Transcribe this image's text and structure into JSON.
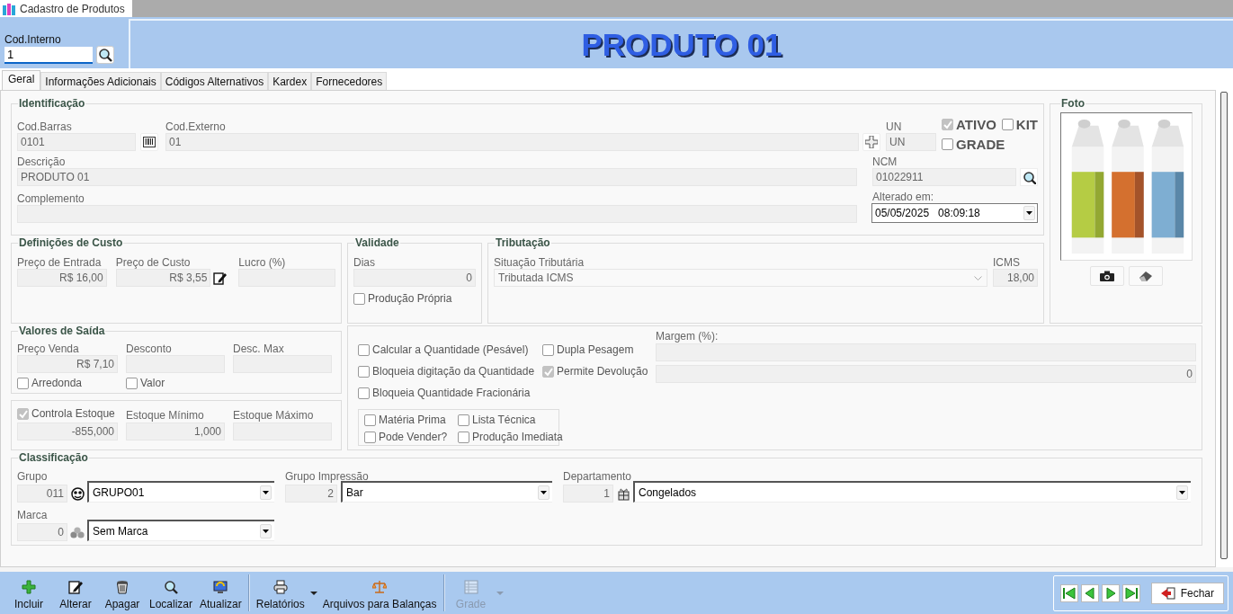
{
  "window_tab": {
    "title": "Cadastro de Produtos",
    "selected": true
  },
  "header": {
    "cod_interno": {
      "label": "Cod.Interno",
      "value": "1"
    },
    "title": "PRODUTO 01"
  },
  "tabs": [
    {
      "label": "Geral",
      "selected": true
    },
    {
      "label": "Informações Adicionais",
      "selected": false
    },
    {
      "label": "Códigos Alternativos",
      "selected": false
    },
    {
      "label": "Kardex",
      "selected": false
    },
    {
      "label": "Fornecedores",
      "selected": false
    }
  ],
  "identificacao": {
    "title": "Identificação",
    "cod_barras": {
      "label": "Cod.Barras",
      "value": "0101"
    },
    "cod_externo": {
      "label": "Cod.Externo",
      "value": "01"
    },
    "un": {
      "label": "UN",
      "value": "UN"
    },
    "flags": [
      {
        "label": "ATIVO",
        "checked": true
      },
      {
        "label": "KIT",
        "checked": false
      },
      {
        "label": "GRADE",
        "checked": false
      }
    ],
    "descricao": {
      "label": "Descrição",
      "value": "PRODUTO 01"
    },
    "ncm": {
      "label": "NCM",
      "value": "01022911"
    },
    "complemento": {
      "label": "Complemento"
    },
    "alterado_em": {
      "label": "Alterado em:",
      "value": "05/05/2025   08:09:18"
    }
  },
  "foto": {
    "title": "Foto"
  },
  "custo": {
    "title": "Definições de Custo",
    "fields": [
      {
        "label": "Preço de Entrada",
        "value": "R$ 16,00",
        "edit_button": false
      },
      {
        "label": "Preço de Custo",
        "value": "R$ 3,55",
        "edit_button": true
      },
      {
        "label": "Lucro (%)",
        "edit_button": false
      }
    ]
  },
  "validade": {
    "title": "Validade",
    "dias": {
      "label": "Dias",
      "value": "0"
    },
    "producao_propria": {
      "label": "Produção Própria",
      "checked": false
    }
  },
  "tributacao": {
    "title": "Tributação",
    "situacao": {
      "label": "Situação Tributária",
      "value": "Tributada ICMS"
    },
    "icms": {
      "label": "ICMS",
      "value": "18,00"
    }
  },
  "valores_saida": {
    "title": "Valores de Saída",
    "fields": [
      {
        "label": "Preço Venda",
        "value": "R$ 7,10"
      },
      {
        "label": "Desconto"
      },
      {
        "label": "Desc. Max"
      }
    ],
    "checks": [
      {
        "label": "Arredonda",
        "checked": false
      },
      {
        "label": "Valor",
        "checked": false
      }
    ]
  },
  "estoque": {
    "columns": [
      {
        "kind": "checkbox",
        "label": "Controla Estoque",
        "checked": true,
        "value": "-855,000"
      },
      {
        "kind": "label",
        "label": "Estoque Mínimo",
        "value": "1,000"
      },
      {
        "kind": "label",
        "label": "Estoque Máximo"
      }
    ]
  },
  "opcoes": {
    "checks": [
      {
        "label": "Calcular a Quantidade (Pesável)",
        "checked": false
      },
      {
        "label": "Dupla Pesagem",
        "checked": false
      },
      {
        "label": "Bloqueia digitação da Quantidade",
        "checked": false
      },
      {
        "label": "Permite Devolução",
        "checked": true
      },
      {
        "label": "Bloqueia Quantidade Fracionária",
        "checked": false
      }
    ],
    "sub_checks": [
      {
        "label": "Matéria Prima",
        "checked": false
      },
      {
        "label": "Lista Técnica",
        "checked": false
      },
      {
        "label": "Pode Vender?",
        "checked": false
      },
      {
        "label": "Produção Imediata",
        "checked": false
      }
    ],
    "margem": {
      "label": "Margem (%):"
    },
    "field_2": {
      "value": "0"
    }
  },
  "classificacao": {
    "title": "Classificação",
    "rows": [
      [
        {
          "label": "Grupo",
          "code": "011",
          "value": "GRUPO01",
          "icon_button": true
        },
        {
          "label": "Grupo Impressão",
          "code": "2",
          "value": "Bar",
          "icon_button": false
        },
        {
          "label": "Departamento",
          "code": "1",
          "value": "Congelados",
          "icon_button": true
        }
      ],
      [
        {
          "label": "Marca",
          "code": "0",
          "value": "Sem Marca",
          "icon_button": true
        }
      ]
    ]
  },
  "toolbar": {
    "groups": [
      [
        {
          "label": "Incluir",
          "disabled": false,
          "has_menu": false
        },
        {
          "label": "Alterar",
          "disabled": false,
          "has_menu": false
        },
        {
          "label": "Apagar",
          "disabled": false,
          "has_menu": false
        },
        {
          "label": "Localizar",
          "disabled": false,
          "has_menu": false
        },
        {
          "label": "Atualizar",
          "disabled": false,
          "has_menu": false
        }
      ],
      [
        {
          "label": "Relatórios",
          "disabled": false,
          "has_menu": true
        },
        {
          "label": "Arquivos para Balanças",
          "disabled": false,
          "has_menu": false
        }
      ],
      [
        {
          "label": "Grade",
          "disabled": true,
          "has_menu": true
        }
      ]
    ],
    "close_button": {
      "label": "Fechar"
    }
  }
}
